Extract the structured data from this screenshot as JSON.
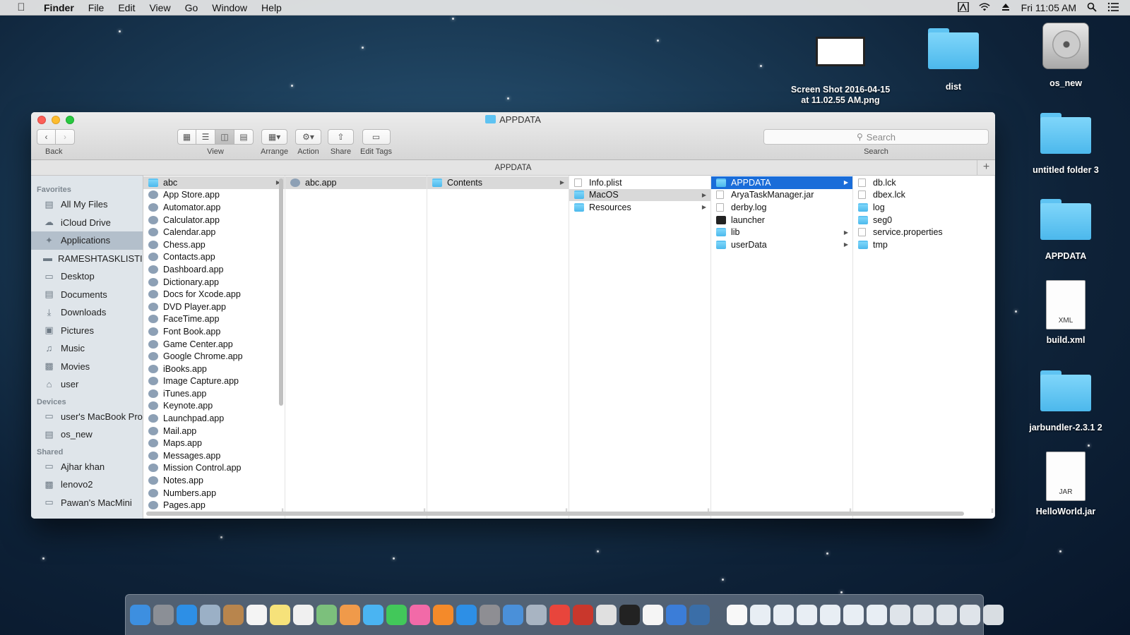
{
  "menubar": {
    "app": "Finder",
    "items": [
      "File",
      "Edit",
      "View",
      "Go",
      "Window",
      "Help"
    ],
    "clock": "Fri 11:05 AM"
  },
  "desktop": {
    "items": [
      {
        "label": "Screen Shot 2016-04-15 at 11.02.55 AM.png",
        "icon": "screenshot-icon"
      },
      {
        "label": "dist",
        "icon": "folder-icon"
      },
      {
        "label": "os_new",
        "icon": "disk-icon"
      },
      {
        "label": "untitled folder 3",
        "icon": "folder-icon"
      },
      {
        "label": "APPDATA",
        "icon": "folder-icon"
      },
      {
        "label": "build.xml",
        "icon": "xml-file-icon",
        "tag": "XML"
      },
      {
        "label": "jarbundler-2.3.1 2",
        "icon": "folder-icon"
      },
      {
        "label": "HelloWorld.jar",
        "icon": "jar-file-icon",
        "tag": "JAR"
      }
    ]
  },
  "window": {
    "title": "APPDATA",
    "path_label": "APPDATA",
    "toolbar": {
      "back_label": "Back",
      "view_label": "View",
      "arrange_label": "Arrange",
      "action_label": "Action",
      "share_label": "Share",
      "edit_tags_label": "Edit Tags",
      "search_placeholder": "Search",
      "search_label": "Search"
    },
    "sidebar": {
      "favorites_header": "Favorites",
      "favorites": [
        {
          "label": "All My Files",
          "icon": "all-files-icon"
        },
        {
          "label": "iCloud Drive",
          "icon": "cloud-icon"
        },
        {
          "label": "Applications",
          "icon": "applications-icon",
          "selected": true
        },
        {
          "label": "RAMESHTASKLISTIOS",
          "icon": "folder-icon"
        },
        {
          "label": "Desktop",
          "icon": "desktop-icon"
        },
        {
          "label": "Documents",
          "icon": "documents-icon"
        },
        {
          "label": "Downloads",
          "icon": "downloads-icon"
        },
        {
          "label": "Pictures",
          "icon": "pictures-icon"
        },
        {
          "label": "Music",
          "icon": "music-icon"
        },
        {
          "label": "Movies",
          "icon": "movies-icon"
        },
        {
          "label": "user",
          "icon": "home-icon"
        }
      ],
      "devices_header": "Devices",
      "devices": [
        {
          "label": "user's MacBook Pro",
          "icon": "laptop-icon"
        },
        {
          "label": "os_new",
          "icon": "disk-icon"
        }
      ],
      "shared_header": "Shared",
      "shared": [
        {
          "label": "Ajhar khan",
          "icon": "network-icon"
        },
        {
          "label": "lenovo2",
          "icon": "monitor-icon"
        },
        {
          "label": "Pawan's MacMini",
          "icon": "network-icon"
        }
      ]
    },
    "columns": [
      [
        {
          "label": "abc",
          "type": "folder",
          "state": "hl",
          "arrow": true
        },
        {
          "label": "App Store.app",
          "type": "app"
        },
        {
          "label": "Automator.app",
          "type": "app"
        },
        {
          "label": "Calculator.app",
          "type": "app"
        },
        {
          "label": "Calendar.app",
          "type": "app"
        },
        {
          "label": "Chess.app",
          "type": "app"
        },
        {
          "label": "Contacts.app",
          "type": "app"
        },
        {
          "label": "Dashboard.app",
          "type": "app"
        },
        {
          "label": "Dictionary.app",
          "type": "app"
        },
        {
          "label": "Docs for Xcode.app",
          "type": "app"
        },
        {
          "label": "DVD Player.app",
          "type": "app"
        },
        {
          "label": "FaceTime.app",
          "type": "app"
        },
        {
          "label": "Font Book.app",
          "type": "app"
        },
        {
          "label": "Game Center.app",
          "type": "app"
        },
        {
          "label": "Google Chrome.app",
          "type": "app"
        },
        {
          "label": "iBooks.app",
          "type": "app"
        },
        {
          "label": "Image Capture.app",
          "type": "app"
        },
        {
          "label": "iTunes.app",
          "type": "app"
        },
        {
          "label": "Keynote.app",
          "type": "app"
        },
        {
          "label": "Launchpad.app",
          "type": "app"
        },
        {
          "label": "Mail.app",
          "type": "app"
        },
        {
          "label": "Maps.app",
          "type": "app"
        },
        {
          "label": "Messages.app",
          "type": "app"
        },
        {
          "label": "Mission Control.app",
          "type": "app"
        },
        {
          "label": "Notes.app",
          "type": "app"
        },
        {
          "label": "Numbers.app",
          "type": "app"
        },
        {
          "label": "Pages.app",
          "type": "app"
        }
      ],
      [
        {
          "label": "abc.app",
          "type": "app",
          "state": "hl"
        }
      ],
      [
        {
          "label": "Contents",
          "type": "folder",
          "state": "hl",
          "arrow": true
        }
      ],
      [
        {
          "label": "Info.plist",
          "type": "file"
        },
        {
          "label": "MacOS",
          "type": "folder",
          "state": "hl",
          "arrow": true
        },
        {
          "label": "Resources",
          "type": "folder",
          "arrow": true
        }
      ],
      [
        {
          "label": "APPDATA",
          "type": "folder",
          "state": "blue",
          "arrow": true
        },
        {
          "label": "AryaTaskManager.jar",
          "type": "file"
        },
        {
          "label": "derby.log",
          "type": "file"
        },
        {
          "label": "launcher",
          "type": "term"
        },
        {
          "label": "lib",
          "type": "folder",
          "arrow": true
        },
        {
          "label": "userData",
          "type": "folder",
          "arrow": true
        }
      ],
      [
        {
          "label": "db.lck",
          "type": "file"
        },
        {
          "label": "dbex.lck",
          "type": "file"
        },
        {
          "label": "log",
          "type": "folder"
        },
        {
          "label": "seg0",
          "type": "folder"
        },
        {
          "label": "service.properties",
          "type": "file"
        },
        {
          "label": "tmp",
          "type": "folder"
        }
      ]
    ]
  },
  "dock": {
    "apps": [
      {
        "icon": "finder-icon",
        "color": "#3d8fe0"
      },
      {
        "icon": "launchpad-icon",
        "color": "#8b8f96"
      },
      {
        "icon": "safari-icon",
        "color": "#2d8fe6"
      },
      {
        "icon": "preview-icon",
        "color": "#9bb0c6"
      },
      {
        "icon": "contacts-icon",
        "color": "#b8854d"
      },
      {
        "icon": "calendar-icon",
        "color": "#f4f4f4"
      },
      {
        "icon": "notes-icon",
        "color": "#f6e27a"
      },
      {
        "icon": "reminders-icon",
        "color": "#f0f0f0"
      },
      {
        "icon": "maps-icon",
        "color": "#7cc07c"
      },
      {
        "icon": "photos-icon",
        "color": "#f09a4a"
      },
      {
        "icon": "messages-icon",
        "color": "#4ab4f2"
      },
      {
        "icon": "facetime-icon",
        "color": "#42c85a"
      },
      {
        "icon": "itunes-icon",
        "color": "#f26aa8"
      },
      {
        "icon": "ibooks-icon",
        "color": "#f48a2a"
      },
      {
        "icon": "app-store-icon",
        "color": "#2d8fe6"
      },
      {
        "icon": "system-preferences-icon",
        "color": "#8e8e93"
      },
      {
        "icon": "xcode-icon",
        "color": "#4a90d9"
      },
      {
        "icon": "network-utility-icon",
        "color": "#a8b4c2"
      },
      {
        "icon": "chrome-icon",
        "color": "#e8453c"
      },
      {
        "icon": "filezilla-icon",
        "color": "#c9372c"
      },
      {
        "icon": "activity-monitor-icon",
        "color": "#e0e0e0"
      },
      {
        "icon": "terminal-icon",
        "color": "#222222"
      },
      {
        "icon": "textedit-icon",
        "color": "#f5f5f5"
      },
      {
        "icon": "xcode-tools-icon",
        "color": "#3b7dd8"
      },
      {
        "icon": "database-icon",
        "color": "#3a6ea8"
      }
    ],
    "docs": [
      {
        "icon": "document-icon",
        "color": "#f8f8f8"
      },
      {
        "icon": "screenshot-icon",
        "color": "#e8eef4"
      },
      {
        "icon": "screenshot-icon",
        "color": "#e8eef4"
      },
      {
        "icon": "screenshot-icon",
        "color": "#e8eef4"
      },
      {
        "icon": "screenshot-icon",
        "color": "#e8eef4"
      },
      {
        "icon": "screenshot-icon",
        "color": "#e8eef4"
      },
      {
        "icon": "screenshot-icon",
        "color": "#e8eef4"
      },
      {
        "icon": "screenshot-icon",
        "color": "#dfe4ea"
      },
      {
        "icon": "screenshot-icon",
        "color": "#dfe4ea"
      },
      {
        "icon": "screenshot-icon",
        "color": "#dfe4ea"
      },
      {
        "icon": "screenshot-icon",
        "color": "#dfe4ea"
      },
      {
        "icon": "trash-icon",
        "color": "#d8dde2"
      }
    ]
  }
}
